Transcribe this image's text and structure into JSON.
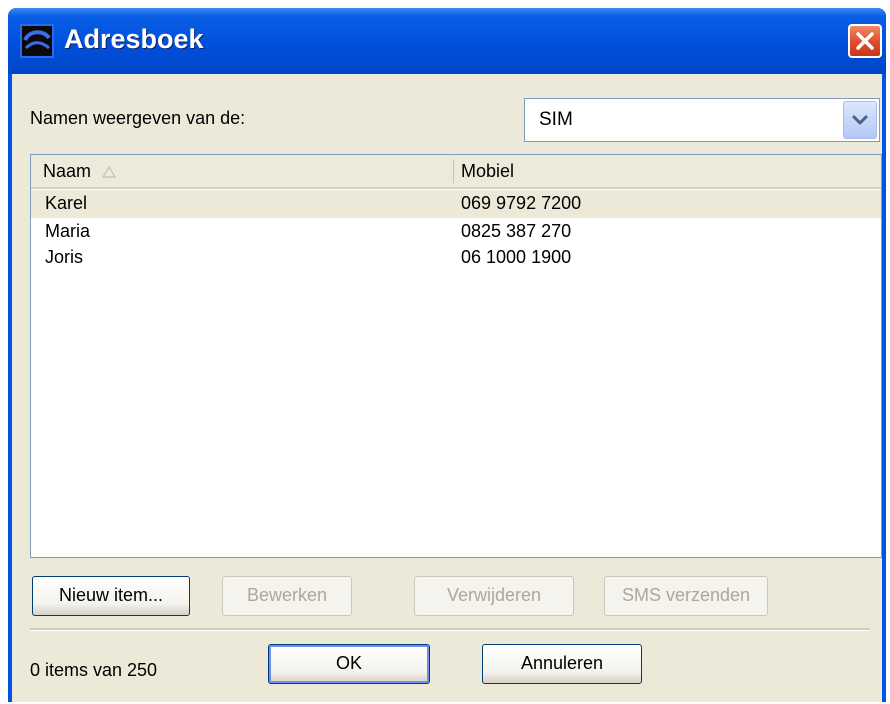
{
  "window": {
    "title": "Adresboek"
  },
  "filter": {
    "label": "Namen weergeven van de:",
    "selected": "SIM"
  },
  "list": {
    "columns": [
      "Naam",
      "Mobiel"
    ],
    "rows": [
      {
        "name": "Karel",
        "mobile": "069 9792 7200"
      },
      {
        "name": "Maria",
        "mobile": "0825 387 270"
      },
      {
        "name": "Joris",
        "mobile": "06 1000 1900"
      }
    ]
  },
  "actions": {
    "new": "Nieuw item...",
    "edit": "Bewerken",
    "delete": "Verwijderen",
    "sms": "SMS verzenden"
  },
  "footer": {
    "status": "0 items van 250",
    "ok": "OK",
    "cancel": "Annuleren"
  }
}
